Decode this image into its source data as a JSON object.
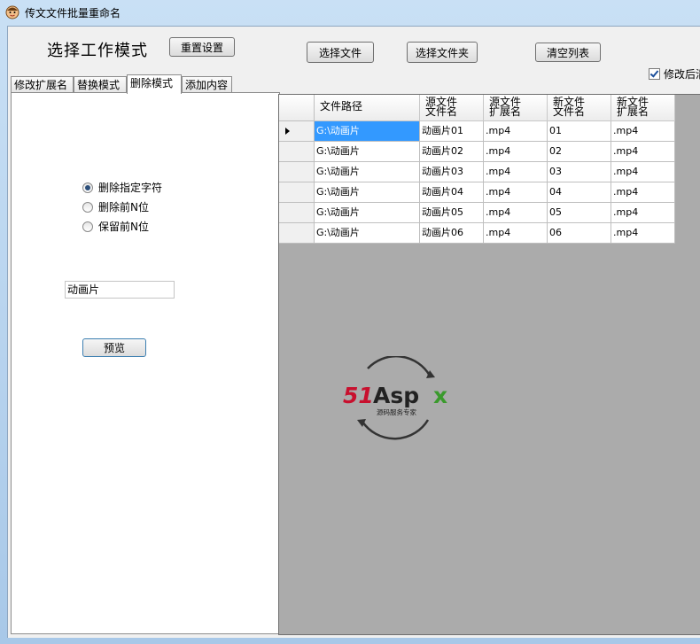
{
  "window": {
    "title": "传文文件批量重命名",
    "icon": "app-face-icon"
  },
  "header": {
    "mode_title": "选择工作模式",
    "reset_label": "重置设置",
    "select_file_label": "选择文件",
    "select_folder_label": "选择文件夹",
    "clear_list_label": "清空列表",
    "checkbox_label": "修改后清",
    "checkbox_checked": true
  },
  "tabs": [
    {
      "label": "修改扩展名",
      "active": false
    },
    {
      "label": "替换模式",
      "active": false
    },
    {
      "label": "删除模式",
      "active": true
    },
    {
      "label": "添加内容",
      "active": false
    }
  ],
  "panel": {
    "radios": [
      {
        "label": "删除指定字符",
        "checked": true
      },
      {
        "label": "删除前N位",
        "checked": false
      },
      {
        "label": "保留前N位",
        "checked": false
      }
    ],
    "input_value": "动画片",
    "preview_label": "预览"
  },
  "grid": {
    "columns": [
      "文件路径",
      "源文件\n文件名",
      "源文件\n扩展名",
      "新文件\n文件名",
      "新文件\n扩展名"
    ],
    "rows": [
      [
        "G:\\动画片",
        "动画片01",
        ".mp4",
        "01",
        ".mp4"
      ],
      [
        "G:\\动画片",
        "动画片02",
        ".mp4",
        "02",
        ".mp4"
      ],
      [
        "G:\\动画片",
        "动画片03",
        ".mp4",
        "03",
        ".mp4"
      ],
      [
        "G:\\动画片",
        "动画片04",
        ".mp4",
        "04",
        ".mp4"
      ],
      [
        "G:\\动画片",
        "动画片05",
        ".mp4",
        "05",
        ".mp4"
      ],
      [
        "G:\\动画片",
        "动画片06",
        ".mp4",
        "06",
        ".mp4"
      ]
    ],
    "selected_row": 0
  },
  "watermark": {
    "brand": "51Aspx",
    "tagline": "源码服务专家",
    "accent": "#c8102e",
    "green": "#3a9a2c"
  }
}
